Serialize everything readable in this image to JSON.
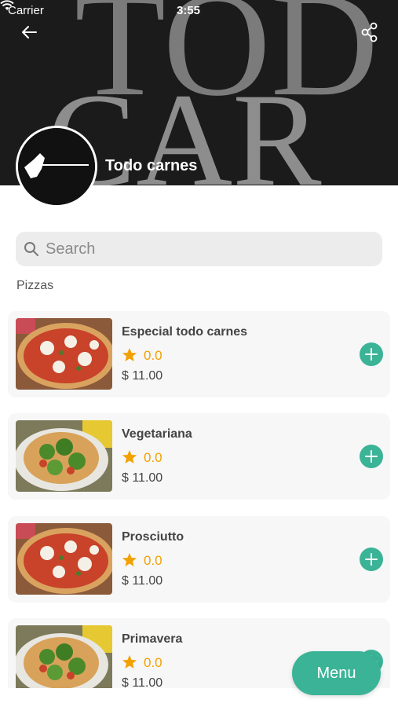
{
  "status_bar": {
    "carrier": "Carrier",
    "time": "3:55"
  },
  "header": {
    "store_name": "Todo carnes",
    "back_icon": "back-arrow-icon",
    "share_icon": "share-icon"
  },
  "search": {
    "placeholder": "Search",
    "value": ""
  },
  "category": "Pizzas",
  "products": [
    {
      "name": "Especial todo carnes",
      "rating": "0.0",
      "price": "$ 11.00",
      "image": "pizza-margherita"
    },
    {
      "name": "Vegetariana",
      "rating": "0.0",
      "price": "$ 11.00",
      "image": "pizza-arugula"
    },
    {
      "name": "Prosciutto",
      "rating": "0.0",
      "price": "$ 11.00",
      "image": "pizza-margherita"
    },
    {
      "name": "Primavera",
      "rating": "0.0",
      "price": "$ 11.00",
      "image": "pizza-arugula"
    }
  ],
  "menu_button": {
    "label": "Menu"
  },
  "colors": {
    "accent": "#3bb396",
    "star": "#f2a100"
  }
}
